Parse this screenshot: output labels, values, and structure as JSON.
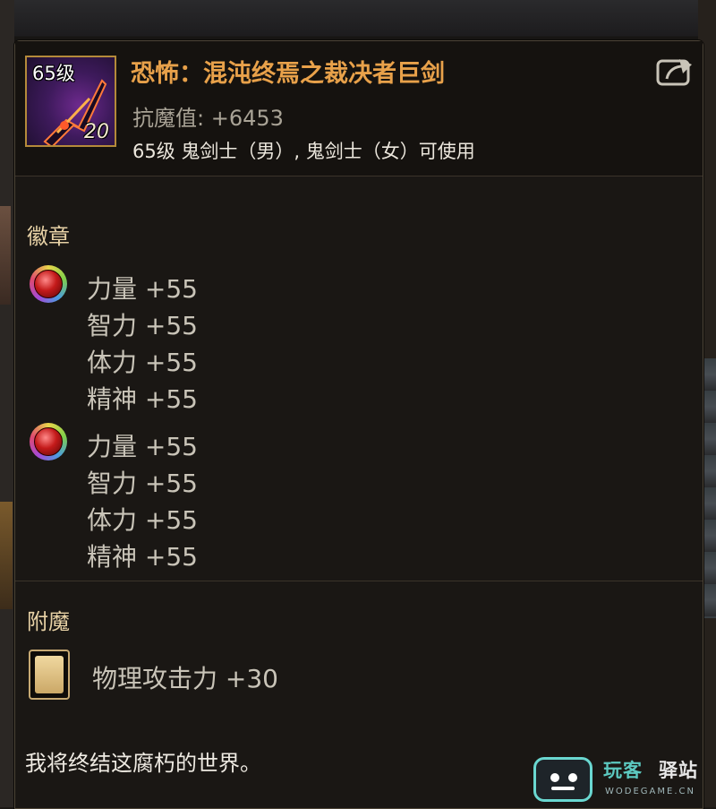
{
  "item": {
    "level_badge": "65级",
    "count": "20",
    "name": "恐怖：混沌终焉之裁决者巨剑",
    "magic_resist": "抗魔值: +6453",
    "usable_by": "65级 鬼剑士（男）, 鬼剑士（女）可使用",
    "icon": "greatsword-icon",
    "share_icon": "share-export-icon"
  },
  "badge_section": {
    "title": "徽章",
    "badges": [
      {
        "icon": "red-gem-icon",
        "stats": [
          "力量 +55",
          "智力 +55",
          "体力 +55",
          "精神 +55"
        ]
      },
      {
        "icon": "red-gem-icon",
        "stats": [
          "力量 +55",
          "智力 +55",
          "体力 +55",
          "精神 +55"
        ]
      }
    ]
  },
  "enchant_section": {
    "title": "附魔",
    "icon": "enchant-card-icon",
    "stat": "物理攻击力 +30"
  },
  "flavor_text": "我将终结这腐朽的世界。",
  "watermark": {
    "title_a": "玩客",
    "title_b": "驿站",
    "subtitle": "WODEGAME.CN"
  },
  "colors": {
    "item_name": "#e8a14a",
    "section_title": "#e8d2a6",
    "stat_text": "#c9c4b8",
    "tooltip_bg": "#1a1714"
  }
}
